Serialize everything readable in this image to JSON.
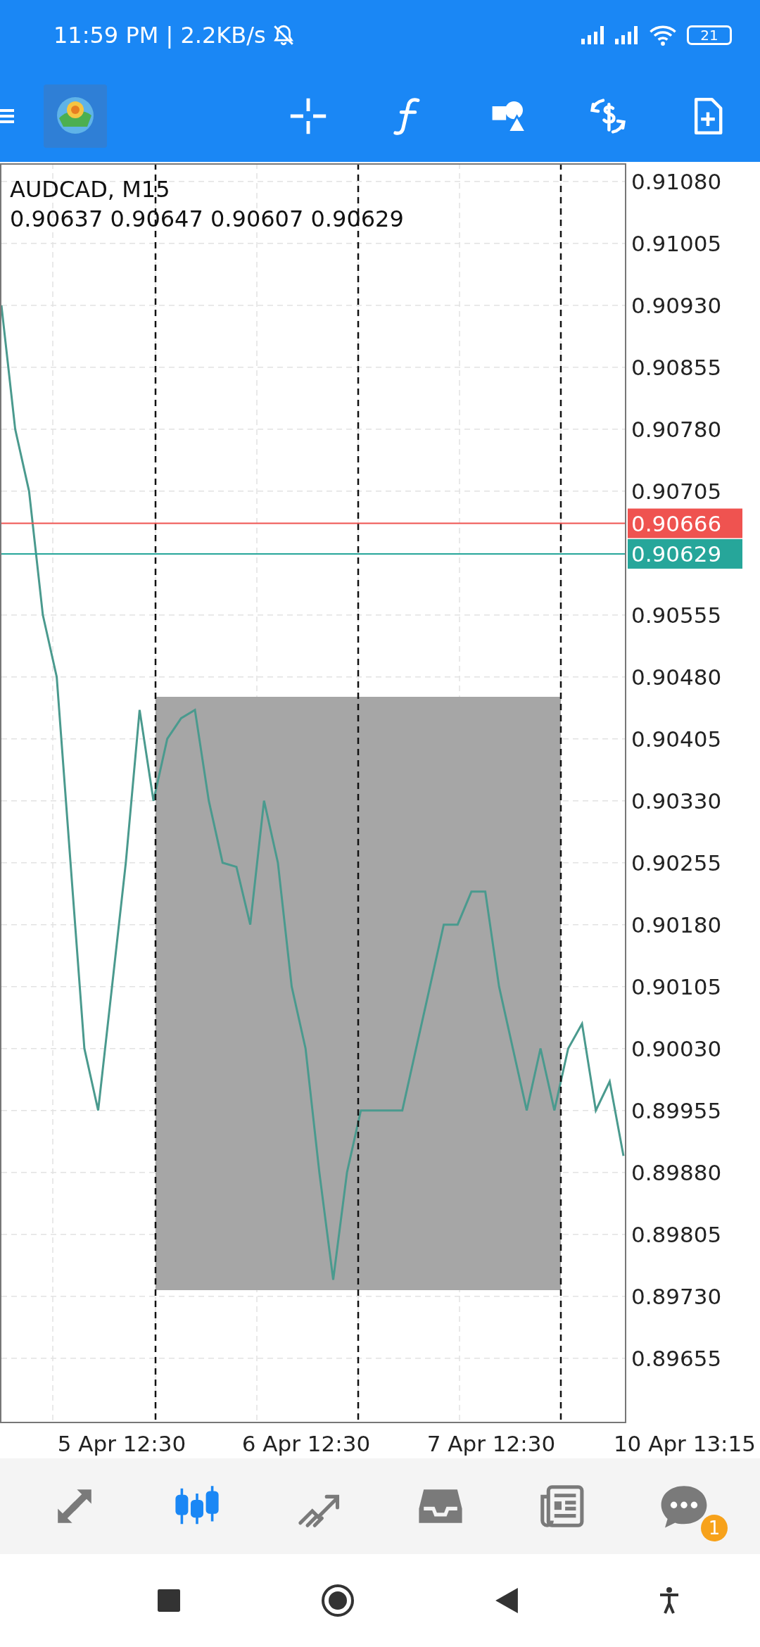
{
  "status_bar": {
    "time": "11:59 PM | 2.2KB/s",
    "battery": "21"
  },
  "toolbar": {
    "tools": [
      {
        "kind": "crosshair"
      },
      {
        "kind": "function"
      },
      {
        "kind": "shapes"
      },
      {
        "kind": "currency"
      },
      {
        "kind": "newdoc"
      }
    ]
  },
  "chart": {
    "symbol": "AUDCAD, M15",
    "ohlc": "0.90637 0.90647 0.90607 0.90629",
    "drawings": [
      {
        "kind": "rectangle"
      },
      {
        "kind": "vline"
      },
      {
        "kind": "vline"
      },
      {
        "kind": "vline"
      }
    ],
    "time_labels": [
      "5 Apr 12:30",
      "6 Apr 12:30",
      "7 Apr 12:30",
      "10 Apr 13:15"
    ],
    "chart_data": {
      "type": "line",
      "grid": true,
      "ylim": [
        0.89578,
        0.91102
      ],
      "yticks": [
        {
          "value": 0.9108,
          "label": "0.91080"
        },
        {
          "value": 0.91005,
          "label": "0.91005"
        },
        {
          "value": 0.9093,
          "label": "0.90930"
        },
        {
          "value": 0.90855,
          "label": "0.90855"
        },
        {
          "value": 0.9078,
          "label": "0.90780"
        },
        {
          "value": 0.90705,
          "label": "0.90705"
        },
        {
          "value": 0.90555,
          "label": "0.90555"
        },
        {
          "value": 0.9048,
          "label": "0.90480"
        },
        {
          "value": 0.90405,
          "label": "0.90405"
        },
        {
          "value": 0.9033,
          "label": "0.90330"
        },
        {
          "value": 0.90255,
          "label": "0.90255"
        },
        {
          "value": 0.9018,
          "label": "0.90180"
        },
        {
          "value": 0.90105,
          "label": "0.90105"
        },
        {
          "value": 0.9003,
          "label": "0.90030"
        },
        {
          "value": 0.89955,
          "label": "0.89955"
        },
        {
          "value": 0.8988,
          "label": "0.89880"
        },
        {
          "value": 0.89805,
          "label": "0.89805"
        },
        {
          "value": 0.8973,
          "label": "0.89730"
        },
        {
          "value": 0.89655,
          "label": "0.89655"
        }
      ],
      "ref_lines": [
        {
          "axis": "y",
          "value": 0.90666,
          "label": "0.90666",
          "color": "#ef5350"
        },
        {
          "axis": "y",
          "value": 0.90629,
          "label": "0.90629",
          "color": "#26a69a"
        }
      ],
      "series": [
        {
          "color": "#4a9a8e",
          "values": [
            0.9093,
            0.9078,
            0.90705,
            0.90555,
            0.9048,
            0.90255,
            0.9003,
            0.89955,
            0.90105,
            0.90255,
            0.9044,
            0.9033,
            0.90405,
            0.9043,
            0.9044,
            0.9033,
            0.90255,
            0.9025,
            0.9018,
            0.9033,
            0.90255,
            0.90105,
            0.9003,
            0.8988,
            0.8975,
            0.8988,
            0.89955,
            0.89955,
            0.89955,
            0.89955,
            0.9003,
            0.90105,
            0.9018,
            0.9018,
            0.9022,
            0.9022,
            0.90105,
            0.9003,
            0.89955,
            0.9003,
            0.89955,
            0.9003,
            0.9006,
            0.89955,
            0.8999,
            0.899
          ]
        }
      ]
    }
  },
  "bottom_nav": [
    {
      "kind": "quotes",
      "selected": false
    },
    {
      "kind": "chart",
      "selected": true
    },
    {
      "kind": "trade",
      "selected": false
    },
    {
      "kind": "history",
      "selected": false
    },
    {
      "kind": "news",
      "selected": false
    },
    {
      "kind": "messages",
      "selected": false,
      "badge": "1"
    }
  ]
}
